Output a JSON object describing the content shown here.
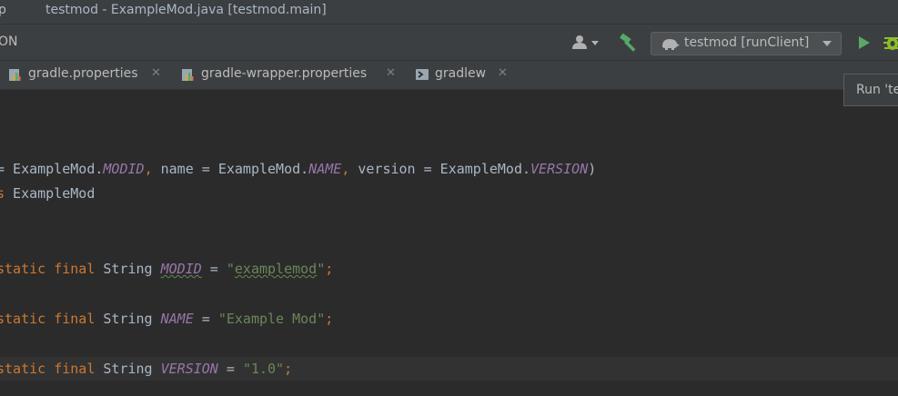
{
  "titlebar": {
    "menu_fragment": "p",
    "title": "testmod - ExampleMod.java [testmod.main]"
  },
  "navbar": {
    "breadcrumb_fragment": "ON",
    "run_config": "testmod [runClient]"
  },
  "tabs": [
    {
      "label": "gradle.properties",
      "icon": "gradle-properties-icon",
      "closable": true
    },
    {
      "label": "gradle-wrapper.properties",
      "icon": "gradle-properties-icon",
      "closable": true
    },
    {
      "label": "gradlew",
      "icon": "terminal-script-icon",
      "closable": true
    }
  ],
  "tooltip": {
    "text": "Run 'te"
  },
  "code": {
    "line1": {
      "p1": "= ExampleMod.",
      "c1": "MODID",
      "p2": ", ",
      "p3": "name = ExampleMod.",
      "c2": "NAME",
      "p4": ", ",
      "p5": "version = ExampleMod.",
      "c3": "VERSION",
      "p6": ")"
    },
    "line2": {
      "kw": "s",
      "rest": " ExampleMod"
    },
    "line3": {
      "kw1": "static",
      "kw2": "final",
      "type": "String",
      "name": "MODID",
      "eq": " = ",
      "q1": "\"",
      "val": "examplemod",
      "q2": "\"",
      "semi": ";"
    },
    "line4": {
      "kw1": "static",
      "kw2": "final",
      "type": "String",
      "name": "NAME",
      "eq": " = ",
      "val": "\"Example Mod\"",
      "semi": ";"
    },
    "line5": {
      "kw1": "static",
      "kw2": "final",
      "type": "String",
      "name": "VERSION",
      "eq": " = ",
      "val": "\"1.0\"",
      "semi": ";"
    }
  },
  "colors": {
    "keyword": "#cc7832",
    "constant": "#9876aa",
    "string": "#6a8759",
    "run_green": "#59a869",
    "debug_green": "#8dbd2b",
    "hammer_green": "#59a869"
  }
}
